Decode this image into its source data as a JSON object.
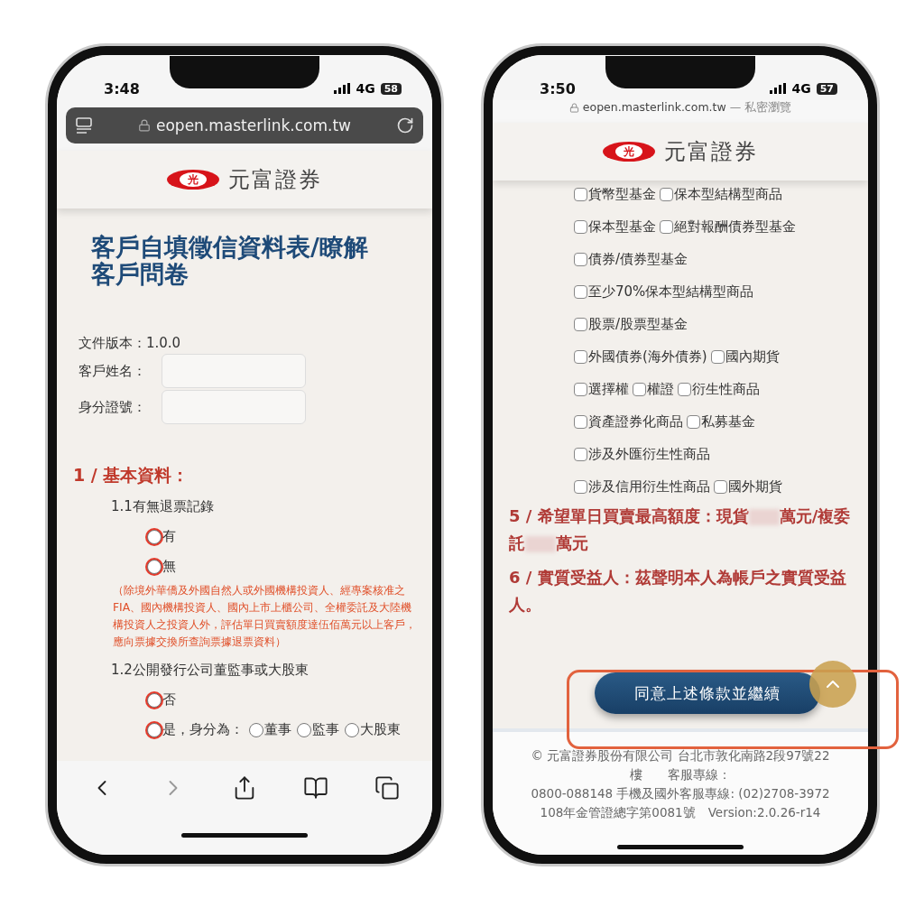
{
  "left_phone": {
    "status": {
      "time": "3:48",
      "network": "4G",
      "battery": "58"
    },
    "address_bar": {
      "url": "eopen.masterlink.com.tw"
    },
    "logo": {
      "mark": "光",
      "name": "元富證券"
    },
    "title": "客戶自填徵信資料表/瞭解客戶問卷",
    "version": "文件版本：1.0.0",
    "fields": [
      {
        "label": "客戶姓名："
      },
      {
        "label": "身分證號："
      }
    ],
    "section": "1 / 基本資料：",
    "questions": [
      {
        "label": "1.1有無退票記錄",
        "options": [
          {
            "label": "有",
            "selected": false,
            "flagged": true
          },
          {
            "label": "無",
            "selected": false,
            "flagged": true
          }
        ],
        "note": "（除境外華僑及外國自然人或外國機構投資人、經專案核准之FIA、國內機構投資人、國內上市上櫃公司、全權委託及大陸機構投資人之投資人外，評估單日買賣額度達伍佰萬元以上客戶，應向票據交換所查詢票據退票資料）"
      },
      {
        "label": "1.2公開發行公司董監事或大股東",
        "options": [
          {
            "label": "否",
            "selected": false,
            "flagged": true
          },
          {
            "label": "是，身分為：",
            "selected": false,
            "flagged": true,
            "sub_options": [
              {
                "label": "董事",
                "selected": false
              },
              {
                "label": "監事",
                "selected": false
              },
              {
                "label": "大股東",
                "selected": false
              }
            ]
          }
        ]
      }
    ],
    "toolbar": [
      {
        "kind": "back",
        "disabled": false
      },
      {
        "kind": "forward",
        "disabled": true
      },
      {
        "kind": "share",
        "disabled": false
      },
      {
        "kind": "bookmarks",
        "disabled": false
      },
      {
        "kind": "tabs",
        "disabled": false
      }
    ]
  },
  "right_phone": {
    "status": {
      "time": "3:50",
      "network": "4G",
      "battery": "57"
    },
    "address": {
      "url": "eopen.masterlink.com.tw",
      "mode": "— 私密瀏覽"
    },
    "logo": {
      "mark": "光",
      "name": "元富證券"
    },
    "checkbox_rows": [
      [
        {
          "label": "貨幣型基金",
          "checked": false
        },
        {
          "label": "保本型結構型商品",
          "checked": false
        }
      ],
      [
        {
          "label": "保本型基金",
          "checked": false
        },
        {
          "label": "絕對報酬債券型基金",
          "checked": false
        }
      ],
      [
        {
          "label": "債券/債券型基金",
          "checked": false
        }
      ],
      [
        {
          "label": "至少70%保本型結構型商品",
          "checked": false
        }
      ],
      [
        {
          "label": "股票/股票型基金",
          "checked": false
        }
      ],
      [
        {
          "label": "外國債券(海外債券)",
          "checked": false
        },
        {
          "label": "國內期貨",
          "checked": false
        }
      ],
      [
        {
          "label": "選擇權",
          "checked": false
        },
        {
          "label": "權證",
          "checked": false
        },
        {
          "label": "衍生性商品",
          "checked": false
        }
      ],
      [
        {
          "label": "資產證券化商品",
          "checked": false
        },
        {
          "label": "私募基金",
          "checked": false
        }
      ],
      [
        {
          "label": "涉及外匯衍生性商品",
          "checked": false
        }
      ],
      [
        {
          "label": "涉及信用衍生性商品",
          "checked": false
        },
        {
          "label": "國外期貨",
          "checked": false
        }
      ]
    ],
    "statements": [
      {
        "parts": [
          "5 / 希望單日買賣最高額度：現貨",
          "萬元/複委託",
          "萬元"
        ]
      },
      {
        "parts": [
          "6 / 實質受益人：茲聲明本人為帳戶之實質受益人。"
        ]
      }
    ],
    "button": "同意上述條款並繼續",
    "footer": [
      "© 元富證券股份有限公司 台北市敦化南路2段97號22",
      "樓　　客服專線：",
      "0800-088148 手機及國外客服專線: (02)2708-3972",
      "108年金管證總字第0081號　Version:2.0.26-r14"
    ]
  }
}
